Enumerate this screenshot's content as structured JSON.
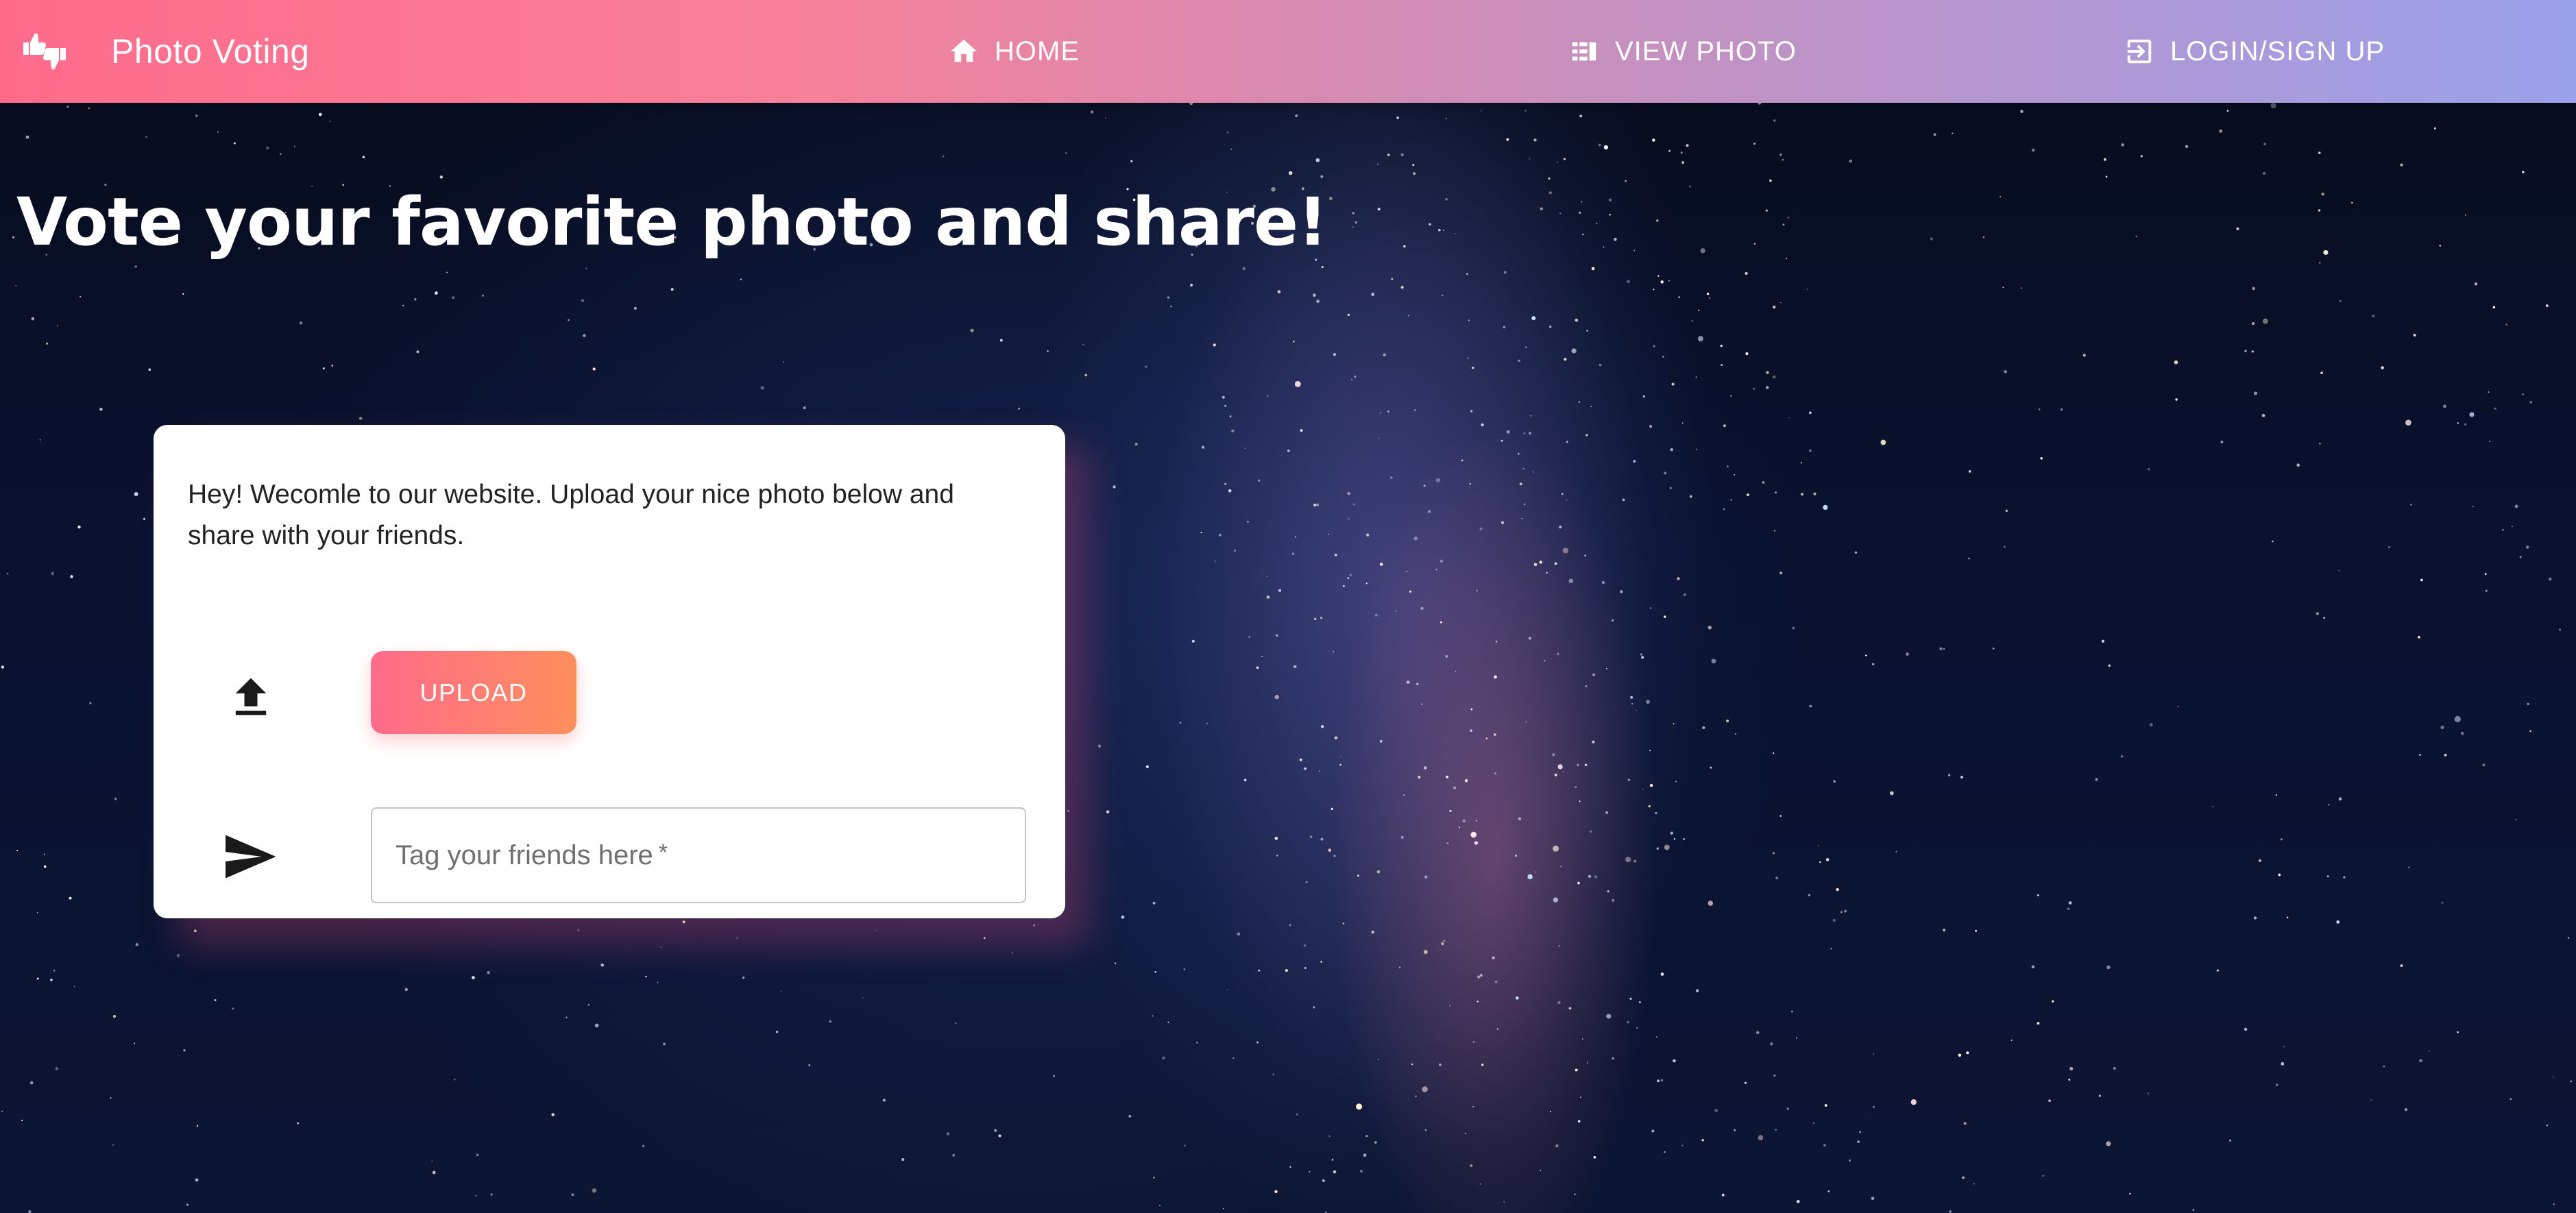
{
  "colors": {
    "nav_gradient_start": "#ff6b8b",
    "nav_gradient_end": "#9aa0ea",
    "button_gradient_start": "#ff6b8b",
    "button_gradient_end": "#ff8f5c",
    "card_background": "#ffffff",
    "heading_text": "#ffffff"
  },
  "header": {
    "brand": {
      "icon": "thumbs-up-down-icon",
      "title": "Photo Voting"
    },
    "nav": [
      {
        "icon": "home-icon",
        "label": "HOME"
      },
      {
        "icon": "view-list-icon",
        "label": "VIEW PHOTO"
      },
      {
        "icon": "login-icon",
        "label": "LOGIN/SIGN UP"
      }
    ]
  },
  "hero": {
    "title": "Vote your favorite photo and share!"
  },
  "card": {
    "welcome_text": "Hey! Wecomle to our website. Upload your nice photo below and share with your friends.",
    "upload": {
      "icon": "upload-icon",
      "button_label": "UPLOAD"
    },
    "tag": {
      "icon": "send-icon",
      "placeholder": "Tag your friends here",
      "required_marker": "*"
    }
  }
}
